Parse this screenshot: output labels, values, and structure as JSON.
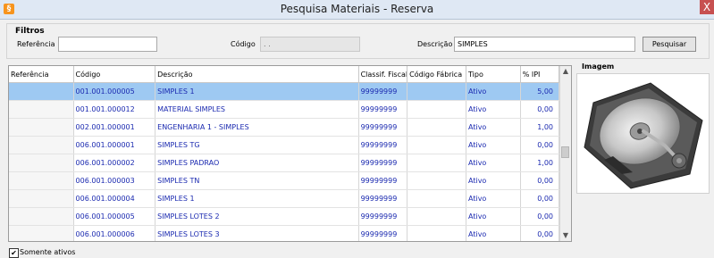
{
  "window": {
    "title": "Pesquisa Materiais - Reserva",
    "close": "X"
  },
  "filters": {
    "section_title": "Filtros",
    "referencia_label": "Referência",
    "referencia_value": "",
    "codigo_label": "Código",
    "codigo_value": " .  .",
    "descricao_label": "Descrição",
    "descricao_value": "SIMPLES",
    "search_button": "Pesquisar"
  },
  "grid": {
    "columns": [
      "Referência",
      "Código",
      "Descrição",
      "Classif. Fiscal",
      "Código Fábrica",
      "Tipo",
      "% IPI"
    ],
    "rows": [
      {
        "ref": "",
        "codigo": "001.001.000005",
        "descricao": "SIMPLES 1",
        "classif": "99999999",
        "fabrica": "",
        "tipo": "Ativo",
        "ipi": "5,00"
      },
      {
        "ref": "",
        "codigo": "001.001.000012",
        "descricao": "MATERIAL SIMPLES",
        "classif": "99999999",
        "fabrica": "",
        "tipo": "Ativo",
        "ipi": "0,00"
      },
      {
        "ref": "",
        "codigo": "002.001.000001",
        "descricao": "ENGENHARIA 1 - SIMPLES",
        "classif": "99999999",
        "fabrica": "",
        "tipo": "Ativo",
        "ipi": "1,00"
      },
      {
        "ref": "",
        "codigo": "006.001.000001",
        "descricao": "SIMPLES TG",
        "classif": "99999999",
        "fabrica": "",
        "tipo": "Ativo",
        "ipi": "0,00"
      },
      {
        "ref": "",
        "codigo": "006.001.000002",
        "descricao": "SIMPLES PADRAO",
        "classif": "99999999",
        "fabrica": "",
        "tipo": "Ativo",
        "ipi": "1,00"
      },
      {
        "ref": "",
        "codigo": "006.001.000003",
        "descricao": "SIMPLES TN",
        "classif": "99999999",
        "fabrica": "",
        "tipo": "Ativo",
        "ipi": "0,00"
      },
      {
        "ref": "",
        "codigo": "006.001.000004",
        "descricao": "SIMPLES 1",
        "classif": "99999999",
        "fabrica": "",
        "tipo": "Ativo",
        "ipi": "0,00"
      },
      {
        "ref": "",
        "codigo": "006.001.000005",
        "descricao": "SIMPLES LOTES 2",
        "classif": "99999999",
        "fabrica": "",
        "tipo": "Ativo",
        "ipi": "0,00"
      },
      {
        "ref": "",
        "codigo": "006.001.000006",
        "descricao": "SIMPLES LOTES 3",
        "classif": "99999999",
        "fabrica": "",
        "tipo": "Ativo",
        "ipi": "0,00"
      }
    ],
    "selected_index": 0
  },
  "image_panel": {
    "title": "Imagem",
    "icon": "hard-drive-icon"
  },
  "footer": {
    "somente_ativos_label": "Somente ativos",
    "somente_ativos_checked": true
  },
  "colors": {
    "selection": "#9ec9f2",
    "cell_text": "#1b2ab0",
    "title_bar": "#dfe8f4",
    "close": "#c75050"
  }
}
